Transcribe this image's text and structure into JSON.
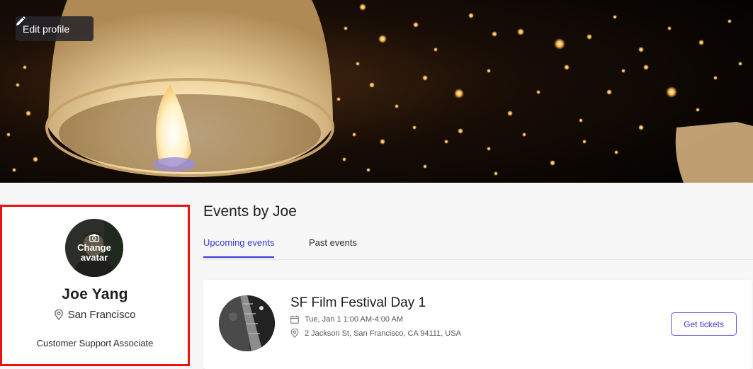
{
  "cover": {
    "edit_label": "Edit profile"
  },
  "profile": {
    "change_avatar_label": "Change avatar",
    "name": "Joe Yang",
    "location": "San Francisco",
    "title": "Customer Support Associate"
  },
  "events": {
    "heading": "Events by Joe",
    "tabs": [
      {
        "label": "Upcoming events",
        "active": true
      },
      {
        "label": "Past events",
        "active": false
      }
    ],
    "items": [
      {
        "title": "SF Film Festival Day 1",
        "date": "Tue, Jan 1 1:00 AM-4:00 AM",
        "address": "2 Jackson St, San Francisco, CA 94111, USA",
        "button_label": "Get tickets"
      }
    ]
  },
  "colors": {
    "accent": "#3a3ad8",
    "highlight_border": "#ee1111"
  }
}
